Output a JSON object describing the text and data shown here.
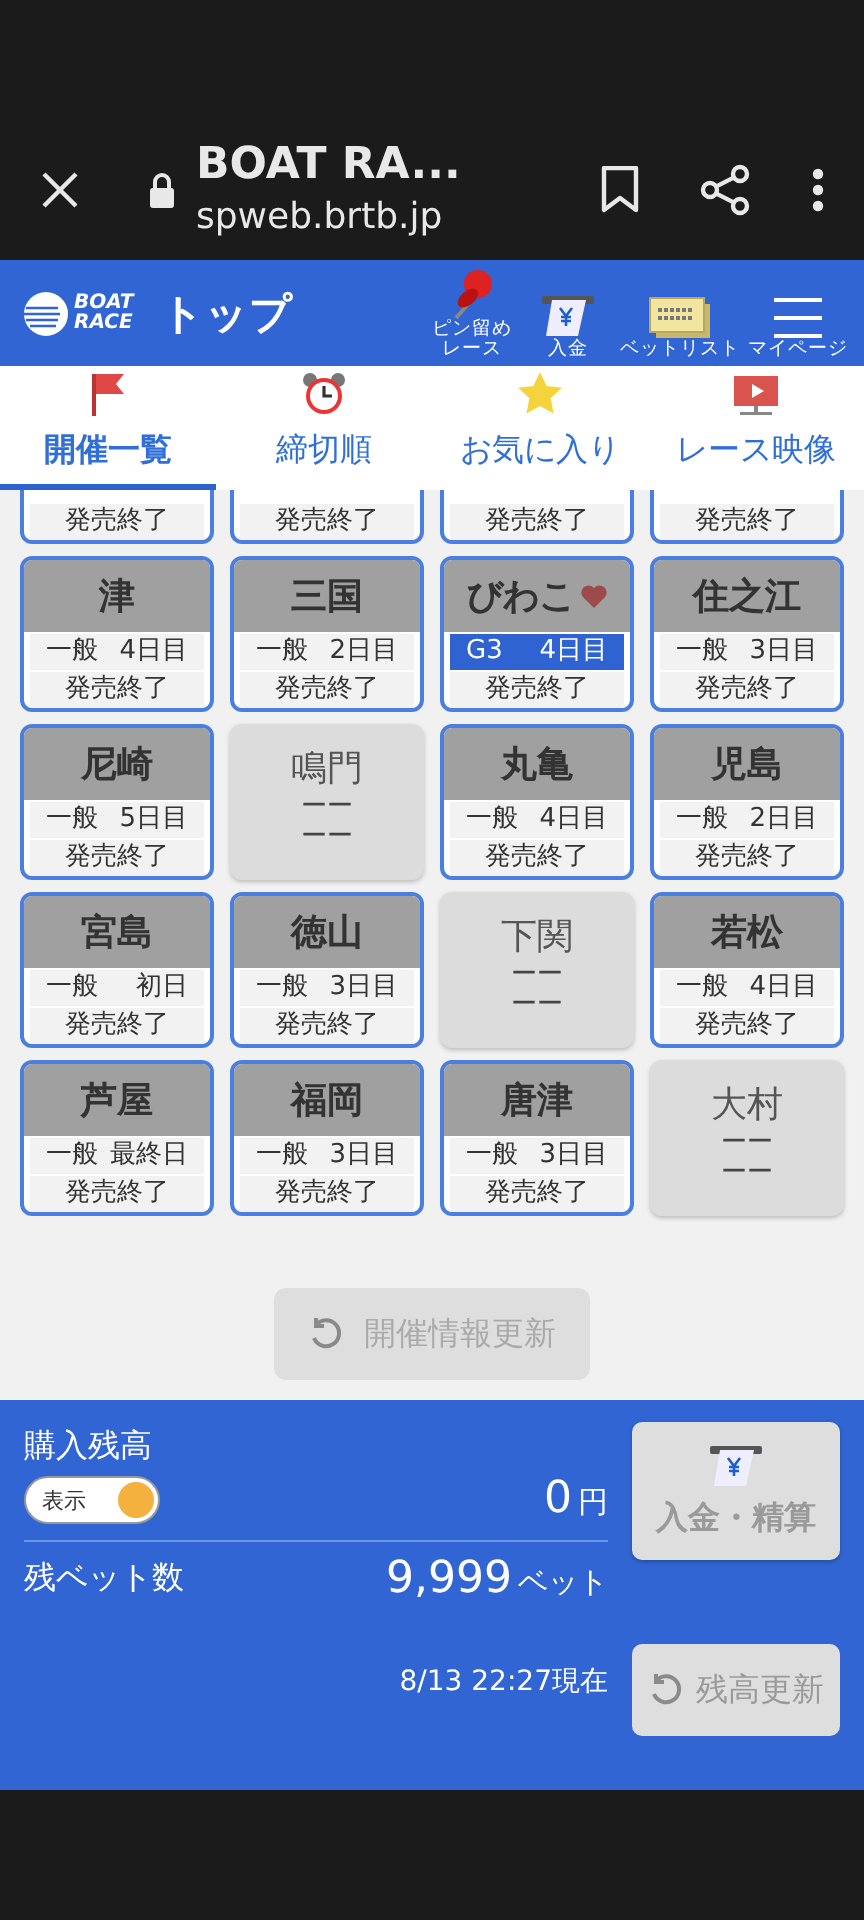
{
  "browser": {
    "title": "BOAT RA...",
    "url": "spweb.brtb.jp"
  },
  "header": {
    "title": "トップ",
    "logo_lines": [
      "BOAT",
      "RACE"
    ],
    "actions": [
      {
        "kind": "pin",
        "lines": [
          "ピン留め",
          "レース"
        ]
      },
      {
        "kind": "deposit",
        "lines": [
          "入金"
        ]
      },
      {
        "kind": "betlist",
        "lines": [
          "ベットリスト"
        ]
      },
      {
        "kind": "menu",
        "lines": [
          "マイページ"
        ]
      }
    ]
  },
  "tabs": [
    {
      "kind": "flag",
      "label": "開催一覧",
      "selected": true
    },
    {
      "kind": "clock",
      "label": "締切順",
      "selected": false
    },
    {
      "kind": "star",
      "label": "お気に入り",
      "selected": false
    },
    {
      "kind": "video",
      "label": "レース映像",
      "selected": false
    }
  ],
  "partial_row": [
    {
      "status": "発売終了"
    },
    {
      "status": "発売終了"
    },
    {
      "status": "発売終了"
    },
    {
      "status": "発売終了"
    }
  ],
  "venues": [
    {
      "kind": "open",
      "name": "津",
      "grade": "一般",
      "day": "4日目",
      "status": "発売終了",
      "highlight": false,
      "favorite": false
    },
    {
      "kind": "open",
      "name": "三国",
      "grade": "一般",
      "day": "2日目",
      "status": "発売終了",
      "highlight": false,
      "favorite": false
    },
    {
      "kind": "open",
      "name": "びわこ",
      "grade": "G3",
      "day": "4日目",
      "status": "発売終了",
      "highlight": true,
      "favorite": true
    },
    {
      "kind": "open",
      "name": "住之江",
      "grade": "一般",
      "day": "3日目",
      "status": "発売終了",
      "highlight": false,
      "favorite": false
    },
    {
      "kind": "open",
      "name": "尼崎",
      "grade": "一般",
      "day": "5日目",
      "status": "発売終了",
      "highlight": false,
      "favorite": false
    },
    {
      "kind": "closed",
      "name": "鳴門",
      "lines": [
        "ーー",
        "ーー"
      ]
    },
    {
      "kind": "open",
      "name": "丸亀",
      "grade": "一般",
      "day": "4日目",
      "status": "発売終了",
      "highlight": false,
      "favorite": false
    },
    {
      "kind": "open",
      "name": "児島",
      "grade": "一般",
      "day": "2日目",
      "status": "発売終了",
      "highlight": false,
      "favorite": false
    },
    {
      "kind": "open",
      "name": "宮島",
      "grade": "一般",
      "day": "初日",
      "status": "発売終了",
      "highlight": false,
      "favorite": false
    },
    {
      "kind": "open",
      "name": "徳山",
      "grade": "一般",
      "day": "3日目",
      "status": "発売終了",
      "highlight": false,
      "favorite": false
    },
    {
      "kind": "closed",
      "name": "下関",
      "lines": [
        "ーー",
        "ーー"
      ]
    },
    {
      "kind": "open",
      "name": "若松",
      "grade": "一般",
      "day": "4日目",
      "status": "発売終了",
      "highlight": false,
      "favorite": false
    },
    {
      "kind": "open",
      "name": "芦屋",
      "grade": "一般",
      "day": "最終日",
      "status": "発売終了",
      "highlight": false,
      "favorite": false
    },
    {
      "kind": "open",
      "name": "福岡",
      "grade": "一般",
      "day": "3日目",
      "status": "発売終了",
      "highlight": false,
      "favorite": false
    },
    {
      "kind": "open",
      "name": "唐津",
      "grade": "一般",
      "day": "3日目",
      "status": "発売終了",
      "highlight": false,
      "favorite": false
    },
    {
      "kind": "closed",
      "name": "大村",
      "lines": [
        "ーー",
        "ーー"
      ]
    }
  ],
  "refresh_button": {
    "label": "開催情報更新",
    "disabled": true
  },
  "balance": {
    "label": "購入残高",
    "toggle": {
      "label": "表示",
      "on": true
    },
    "amount": "0",
    "unit": "円",
    "bets_label": "残ベット数",
    "bets": "9,999",
    "bets_unit": "ベット",
    "timestamp": "8/13 22:27現在",
    "deposit_button": "入金・精算",
    "update_button": "残高更新"
  }
}
